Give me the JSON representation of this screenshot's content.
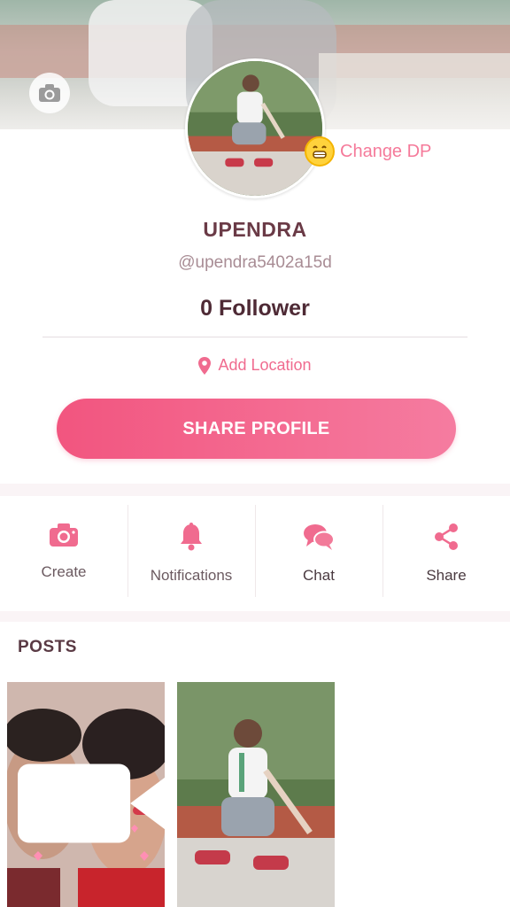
{
  "profile": {
    "name": "UPENDRA",
    "handle": "@upendra5402a15d",
    "followers": "0 Follower",
    "change_dp": "Change DP",
    "add_location": "Add Location",
    "share_profile": "SHARE PROFILE"
  },
  "actions": [
    {
      "label": "Create",
      "icon": "camera-icon"
    },
    {
      "label": "Notifications",
      "icon": "bell-icon"
    },
    {
      "label": "Chat",
      "icon": "chat-icon"
    },
    {
      "label": "Share",
      "icon": "share-icon"
    }
  ],
  "posts": {
    "title": "POSTS",
    "items": [
      {
        "type": "video",
        "icon": "video-camera-icon"
      },
      {
        "type": "photo"
      }
    ]
  },
  "colors": {
    "accent": "#f2557f",
    "accent_light": "#f57ca0",
    "name_text": "#6a3a46"
  }
}
